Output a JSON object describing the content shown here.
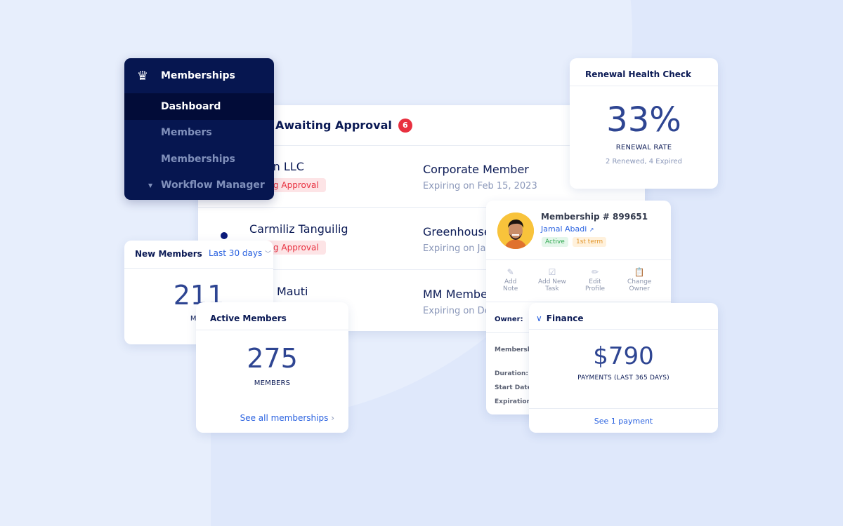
{
  "sidebar": {
    "title": "Memberships",
    "icon": "crown-icon",
    "items": [
      {
        "label": "Dashboard",
        "active": true
      },
      {
        "label": "Members",
        "active": false
      },
      {
        "label": "Memberships",
        "active": false
      },
      {
        "label": "Workflow Manager",
        "active": false,
        "expandable": true
      }
    ]
  },
  "approval": {
    "title": "Awaiting Approval",
    "count": "6",
    "rows": [
      {
        "name": "lion LLC",
        "status": "iting Approval",
        "plan": "Corporate Member",
        "expiry": "Expiring on Feb 15, 2023"
      },
      {
        "name": "Carmiliz Tanguilig",
        "status": "iting Approval",
        "plan": "Greenhouse",
        "expiry": "Expiring on Ja"
      },
      {
        "name": "Mauti",
        "status": "",
        "plan": "MM Membe",
        "expiry": "Expiring on De"
      }
    ]
  },
  "renewal": {
    "title": "Renewal Health Check",
    "value": "33%",
    "label": "RENEWAL RATE",
    "detail": "2 Renewed, 4 Expired"
  },
  "profile": {
    "membership_number": "Membership # 899651",
    "name": "Jamal Abadi",
    "status_tag": "Active",
    "term_tag": "1st term",
    "actions": [
      {
        "line1": "Add",
        "line2": "Note",
        "icon": "note-edit-icon"
      },
      {
        "line1": "Add New",
        "line2": "Task",
        "icon": "task-check-icon"
      },
      {
        "line1": "Edit",
        "line2": "Profile",
        "icon": "pencil-icon"
      },
      {
        "line1": "Change",
        "line2": "Owner",
        "icon": "clipboard-icon"
      }
    ],
    "owner_label": "Owner:",
    "fields": [
      "Membershi",
      "Duration:",
      "Start Date:",
      "Expiration I"
    ]
  },
  "new_members": {
    "title": "New Members",
    "range": "Last 30 days",
    "value": "211",
    "label": "MEM"
  },
  "active_members": {
    "title": "Active Members",
    "value": "275",
    "label": "MEMBERS",
    "link": "See all memberships"
  },
  "finance": {
    "title": "Finance",
    "value": "$790",
    "label": "PAYMENTS (LAST 365 DAYS)",
    "link": "See 1 payment"
  }
}
